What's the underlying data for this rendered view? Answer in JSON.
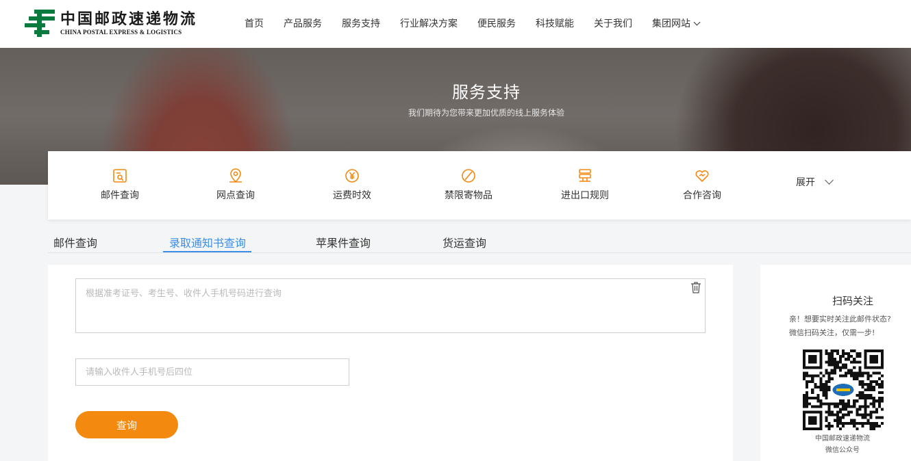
{
  "colors": {
    "brand_green": "#0b7a3e",
    "accent_orange": "#f3890f",
    "link_blue": "#3a8ee6"
  },
  "logo": {
    "cn": "中国邮政速递物流",
    "en": "CHINA POSTAL EXPRESS & LOGISTICS"
  },
  "nav": {
    "items": [
      {
        "label": "首页"
      },
      {
        "label": "产品服务"
      },
      {
        "label": "服务支持"
      },
      {
        "label": "行业解决方案"
      },
      {
        "label": "便民服务"
      },
      {
        "label": "科技赋能"
      },
      {
        "label": "关于我们"
      },
      {
        "label": "集团网站"
      }
    ]
  },
  "banner": {
    "title": "服务支持",
    "subtitle": "我们期待为您带来更加优质的线上服务体验"
  },
  "services": {
    "items": [
      {
        "label": "邮件查询",
        "icon": "mail-search-icon"
      },
      {
        "label": "网点查询",
        "icon": "location-pin-icon"
      },
      {
        "label": "运费时效",
        "icon": "yen-coin-icon"
      },
      {
        "label": "禁限寄物品",
        "icon": "prohibited-icon"
      },
      {
        "label": "进出口规则",
        "icon": "rules-icon"
      },
      {
        "label": "合作咨询",
        "icon": "heart-handshake-icon"
      }
    ],
    "expand_label": "展开"
  },
  "tabs": {
    "items": [
      {
        "label": "邮件查询"
      },
      {
        "label": "录取通知书查询"
      },
      {
        "label": "苹果件查询"
      },
      {
        "label": "货运查询"
      }
    ],
    "active": "录取通知书查询"
  },
  "form": {
    "query_placeholder": "根据准考证号、考生号、收件人手机号码进行查询",
    "phone_placeholder": "请输入收件人手机号后四位",
    "submit_label": "查询"
  },
  "qr": {
    "title": "扫码关注",
    "desc_line1": "亲！想要实时关注此邮件状态?",
    "desc_line2": "微信扫码关注，仅需一步!",
    "caption1": "中国邮政速递物流",
    "caption2": "微信公众号"
  }
}
